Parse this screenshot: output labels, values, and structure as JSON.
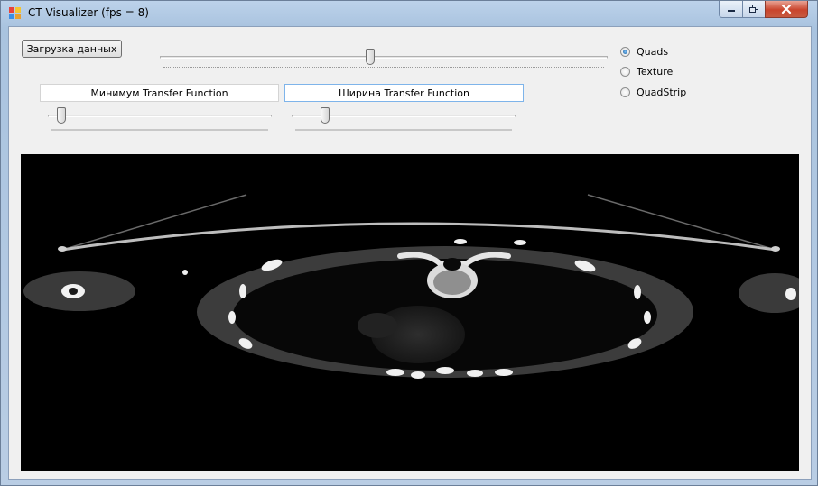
{
  "window": {
    "title": "CT Visualizer (fps = 8)"
  },
  "controls": {
    "load_button": "Загрузка данных",
    "layer_slider": {
      "value_fraction": 0.47
    },
    "tf_min_label": "Минимум Transfer Function",
    "tf_width_label": "Ширина Transfer Function",
    "tf_min_slider": {
      "value_fraction": 0.06
    },
    "tf_width_slider": {
      "value_fraction": 0.15
    }
  },
  "render_modes": [
    {
      "label": "Quads",
      "checked": true
    },
    {
      "label": "Texture",
      "checked": false
    },
    {
      "label": "QuadStrip",
      "checked": false
    }
  ],
  "viewport": {
    "content": "CT axial slice rendering",
    "background": "#000000"
  },
  "colors": {
    "client_bg": "#f0f0f0",
    "title_bar": "#b9cde4",
    "close_button": "#c9452d"
  }
}
